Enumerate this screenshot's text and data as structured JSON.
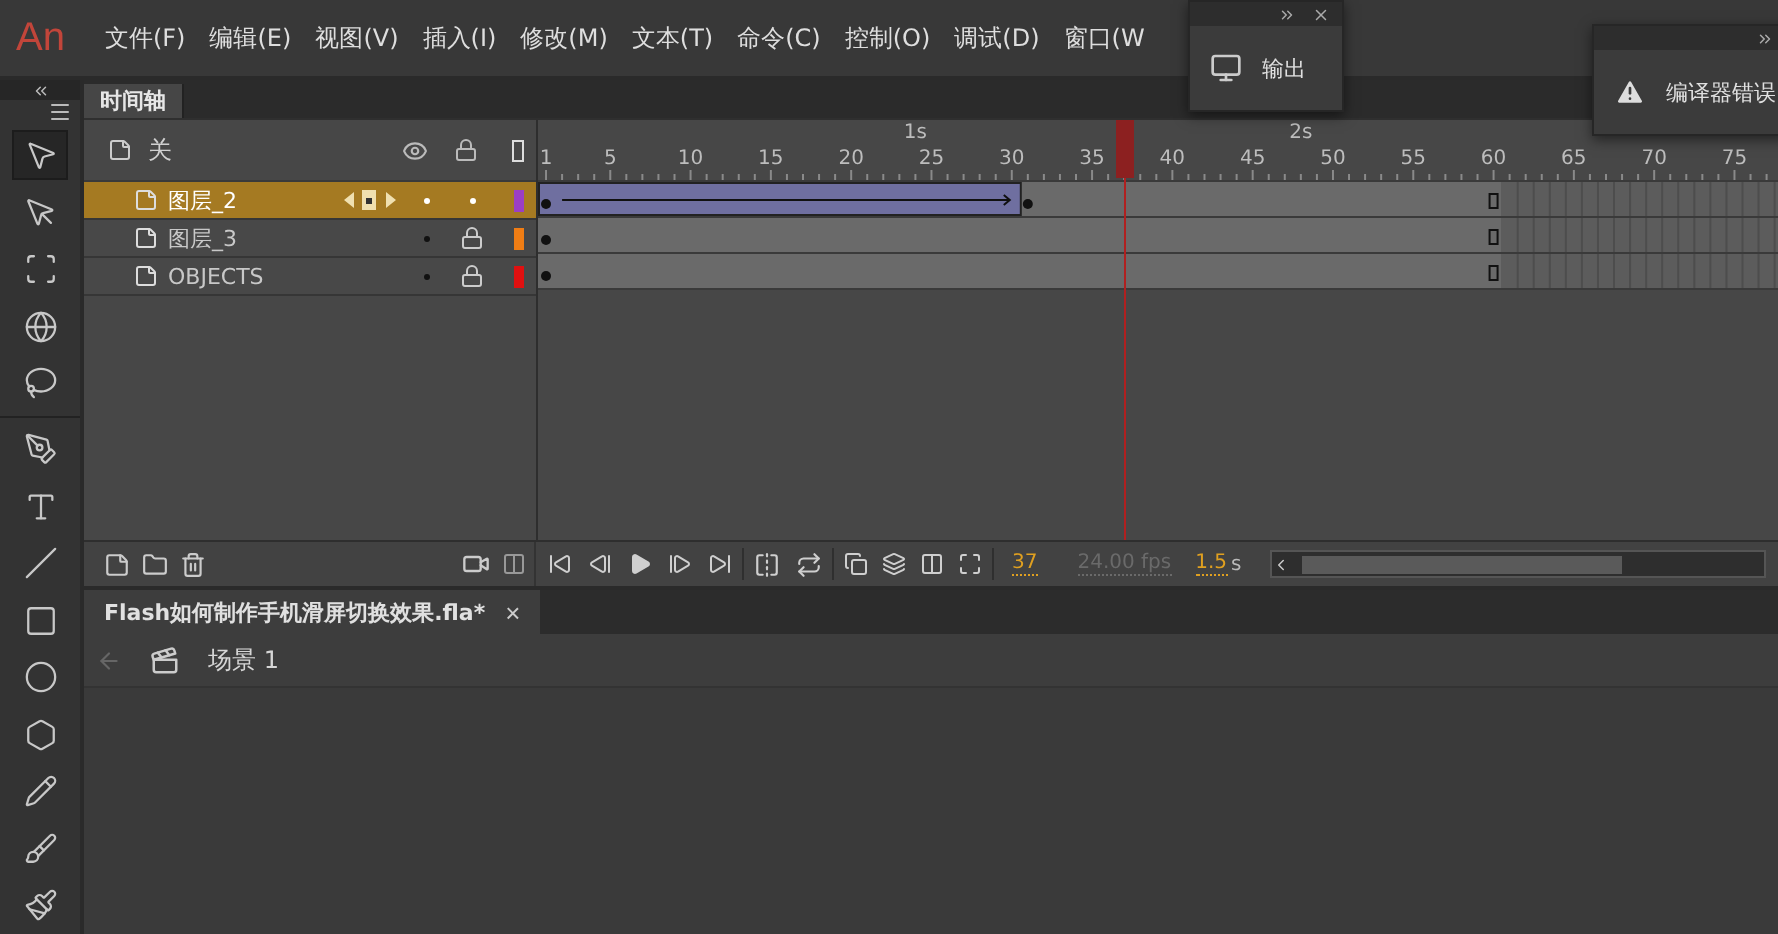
{
  "app": {
    "logo": "An"
  },
  "menu": [
    {
      "label": "文件(F)"
    },
    {
      "label": "编辑(E)"
    },
    {
      "label": "视图(V)"
    },
    {
      "label": "插入(I)"
    },
    {
      "label": "修改(M)"
    },
    {
      "label": "文本(T)"
    },
    {
      "label": "命令(C)"
    },
    {
      "label": "控制(O)"
    },
    {
      "label": "调试(D)"
    },
    {
      "label": "窗口(W"
    }
  ],
  "floating_panels": [
    {
      "kind": "output",
      "label": "输出",
      "closable": true
    },
    {
      "kind": "errors",
      "label": "编译器错误",
      "closable": false
    }
  ],
  "toolbar": {
    "tools": [
      {
        "kind": "selection",
        "selected": true
      },
      {
        "kind": "subselection",
        "selected": false
      },
      {
        "kind": "free-transform",
        "selected": false
      },
      {
        "kind": "rotate-3d",
        "selected": false
      },
      {
        "kind": "lasso",
        "selected": false
      },
      {
        "kind": "pen",
        "selected": false
      },
      {
        "kind": "text",
        "selected": false
      },
      {
        "kind": "line",
        "selected": false
      },
      {
        "kind": "rectangle",
        "selected": false
      },
      {
        "kind": "oval",
        "selected": false
      },
      {
        "kind": "polygon",
        "selected": false
      },
      {
        "kind": "pencil",
        "selected": false
      },
      {
        "kind": "paint-brush",
        "selected": false
      },
      {
        "kind": "brush",
        "selected": false
      }
    ]
  },
  "timeline": {
    "tab": "时间轴",
    "header_label": "关",
    "time_markers": [
      {
        "label": "1s"
      },
      {
        "label": "2s"
      }
    ],
    "frame_numbers": [
      "1",
      "5",
      "10",
      "15",
      "20",
      "25",
      "30",
      "35",
      "40",
      "45",
      "50",
      "55",
      "60",
      "65",
      "70",
      "75"
    ],
    "layers": [
      {
        "name": "图层_2",
        "selected": true,
        "locked": false,
        "color": "#9b3fc4",
        "tween": true
      },
      {
        "name": "图层_3",
        "selected": false,
        "locked": true,
        "color": "#f07d14",
        "tween": false
      },
      {
        "name": "OBJECTS",
        "selected": false,
        "locked": true,
        "color": "#e01010",
        "tween": false
      }
    ],
    "current_frame": "37",
    "frame_rate": "24.00 fps",
    "elapsed": "1.5",
    "elapsed_unit": "s"
  },
  "document": {
    "tab": "Flash如何制作手机滑屏切换效果.fla*",
    "close": "×",
    "scene": "场景 1"
  }
}
